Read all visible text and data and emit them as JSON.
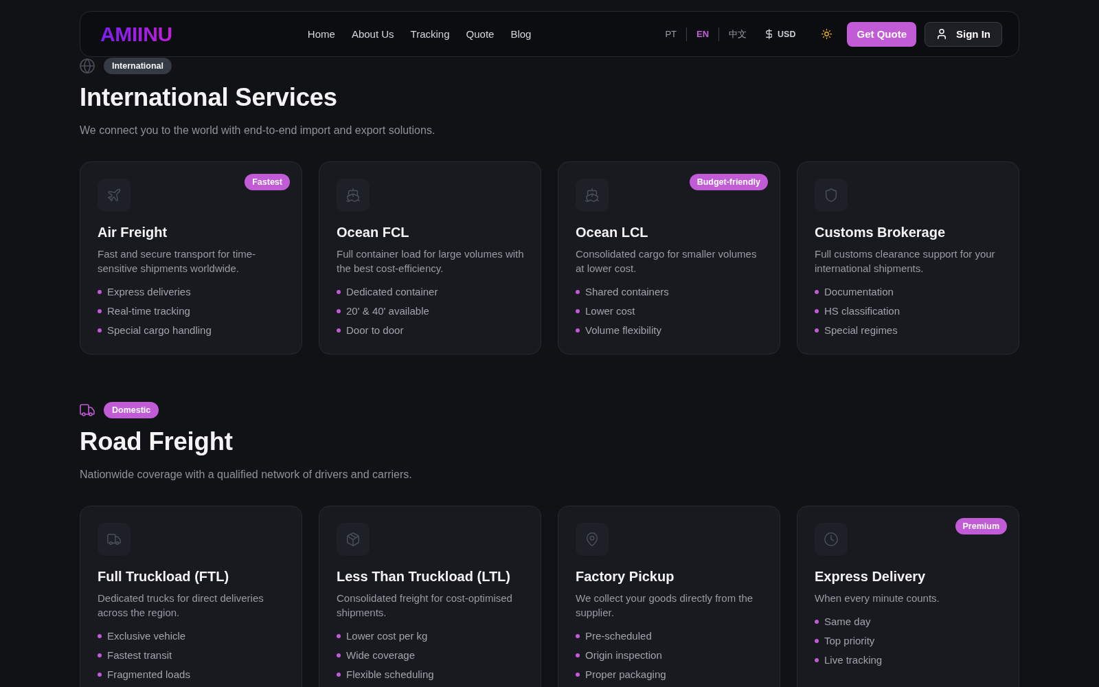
{
  "header": {
    "logo": "AMIINU",
    "nav": [
      "Home",
      "About Us",
      "Tracking",
      "Quote",
      "Blog"
    ],
    "languages": [
      {
        "label": "PT",
        "selected": false
      },
      {
        "label": "EN",
        "selected": true
      },
      {
        "label": "中文",
        "selected": false
      }
    ],
    "currency": "USD",
    "quote_button": "Get Quote",
    "sign_in_button": "Sign In"
  },
  "sections": [
    {
      "tag": "International",
      "highlighted": false,
      "title": "International Services",
      "subtitle": "We connect you to the world with end-to-end import and export solutions.",
      "cards": [
        {
          "title": "Air Freight",
          "badge": "Fastest",
          "description": "Fast and secure transport for time-sensitive shipments worldwide.",
          "features": [
            "Express deliveries",
            "Real-time tracking",
            "Special cargo handling"
          ]
        },
        {
          "title": "Ocean FCL",
          "description": "Full container load for large volumes with the best cost-efficiency.",
          "features": [
            "Dedicated container",
            "20' & 40' available",
            "Door to door"
          ]
        },
        {
          "title": "Ocean LCL",
          "badge": "Budget-friendly",
          "description": "Consolidated cargo for smaller volumes at lower cost.",
          "features": [
            "Shared containers",
            "Lower cost",
            "Volume flexibility"
          ]
        },
        {
          "title": "Customs Brokerage",
          "description": "Full customs clearance support for your international shipments.",
          "features": [
            "Documentation",
            "HS classification",
            "Special regimes"
          ]
        }
      ]
    },
    {
      "tag": "Domestic",
      "highlighted": true,
      "title": "Road Freight",
      "subtitle": "Nationwide coverage with a qualified network of drivers and carriers.",
      "cards": [
        {
          "title": "Full Truckload (FTL)",
          "description": "Dedicated trucks for direct deliveries across the region.",
          "features": [
            "Exclusive vehicle",
            "Fastest transit",
            "Fragmented loads"
          ]
        },
        {
          "title": "Less Than Truckload (LTL)",
          "description": "Consolidated freight for cost-optimised shipments.",
          "features": [
            "Lower cost per kg",
            "Wide coverage",
            "Flexible scheduling"
          ]
        },
        {
          "title": "Factory Pickup",
          "description": "We collect your goods directly from the supplier.",
          "features": [
            "Pre-scheduled",
            "Origin inspection",
            "Proper packaging"
          ]
        },
        {
          "title": "Express Delivery",
          "badge": "Premium",
          "description": "When every minute counts.",
          "features": [
            "Same day",
            "Top priority",
            "Live tracking"
          ]
        }
      ]
    }
  ]
}
